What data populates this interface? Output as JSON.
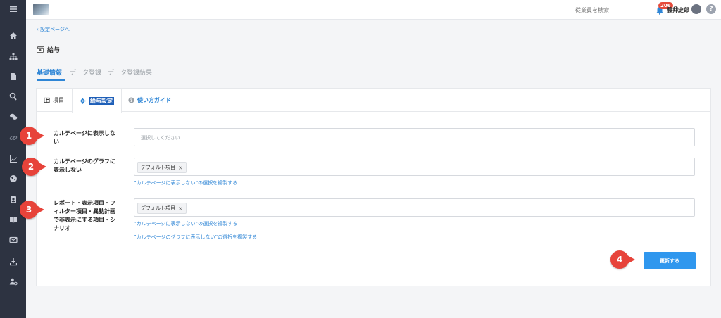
{
  "topbar": {
    "search_placeholder": "従業員を検索",
    "notification_count": "206",
    "user_name": "藤井史郎",
    "help_glyph": "?"
  },
  "breadcrumb": {
    "back_label": "設定ページへ"
  },
  "page": {
    "title": "給与"
  },
  "main_tabs": [
    {
      "label": "基礎情報",
      "active": true
    },
    {
      "label": "データ登録",
      "active": false
    },
    {
      "label": "データ登録結果",
      "active": false
    }
  ],
  "sub_tabs": [
    {
      "label": "項目",
      "icon": "table-icon"
    },
    {
      "label": "給与設定",
      "icon": "gear-icon",
      "active": true
    },
    {
      "label": "使い方ガイド",
      "icon": "question-circle-icon"
    }
  ],
  "fields": [
    {
      "label_lines": [
        "カルテページに表示しな",
        "い"
      ],
      "placeholder": "選択してください",
      "tags": [],
      "links": []
    },
    {
      "label_lines": [
        "カルテページのグラフに",
        "表示しない"
      ],
      "tags": [
        "デフォルト項目"
      ],
      "links": [
        "”カルテページに表示しない”の選択を複製する"
      ]
    },
    {
      "label_lines": [
        "レポート・表示項目・フ",
        "ィルター項目・異動計画",
        "で非表示にする項目・シ",
        "ナリオ"
      ],
      "tags": [
        "デフォルト項目"
      ],
      "links": [
        "”カルテページに表示しない”の選択を複製する",
        "”カルテページのグラフに表示しない”の選択を複製する"
      ]
    }
  ],
  "tag_remove_glyph": "×",
  "actions": {
    "update_label": "更新する"
  },
  "callouts": [
    "1",
    "2",
    "3",
    "4"
  ],
  "colors": {
    "sidebar": "#2d3341",
    "accent": "#2f86d6",
    "button": "#2f97ee",
    "callout": "#e7433a"
  }
}
